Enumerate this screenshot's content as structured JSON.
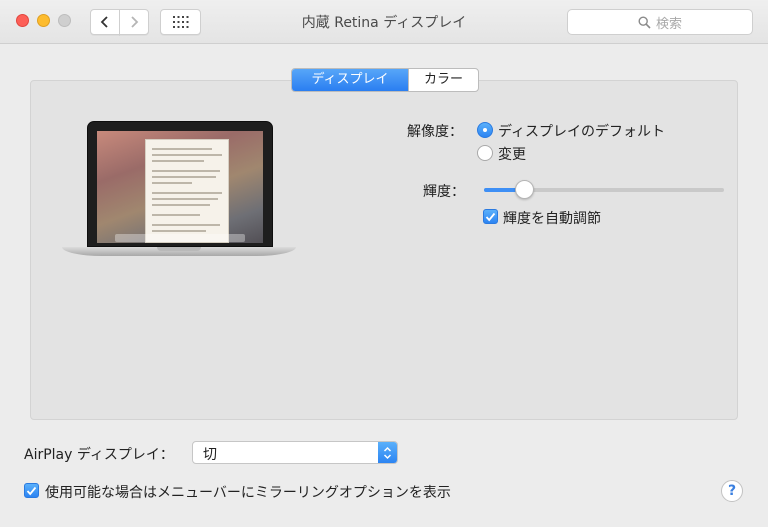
{
  "window": {
    "title": "内蔵 Retina ディスプレイ",
    "search_placeholder": "検索"
  },
  "icons": {
    "close": "window-close-icon",
    "minimize": "window-minimize-icon",
    "zoom": "window-zoom-icon",
    "back": "chevron-left-icon",
    "forward": "chevron-right-icon",
    "show_all": "grid-icon",
    "search": "magnifier-icon",
    "help": "help-icon"
  },
  "tabs": [
    {
      "label": "ディスプレイ",
      "selected": true
    },
    {
      "label": "カラー",
      "selected": false
    }
  ],
  "resolution": {
    "label": "解像度：",
    "options": [
      {
        "label": "ディスプレイのデフォルト",
        "selected": true
      },
      {
        "label": "変更",
        "selected": false
      }
    ]
  },
  "brightness": {
    "label": "輝度：",
    "level": 0.17,
    "auto_label": "輝度を自動調節",
    "auto_checked": true
  },
  "airplay": {
    "label": "AirPlay ディスプレイ：",
    "value": "切"
  },
  "mirroring": {
    "label": "使用可能な場合はメニューバーにミラーリングオプションを表示",
    "checked": true
  },
  "help": {
    "symbol": "?"
  },
  "colors": {
    "accent": "#2c84f2",
    "window_bg": "#ececec",
    "panel_bg": "#e3e3e3"
  }
}
